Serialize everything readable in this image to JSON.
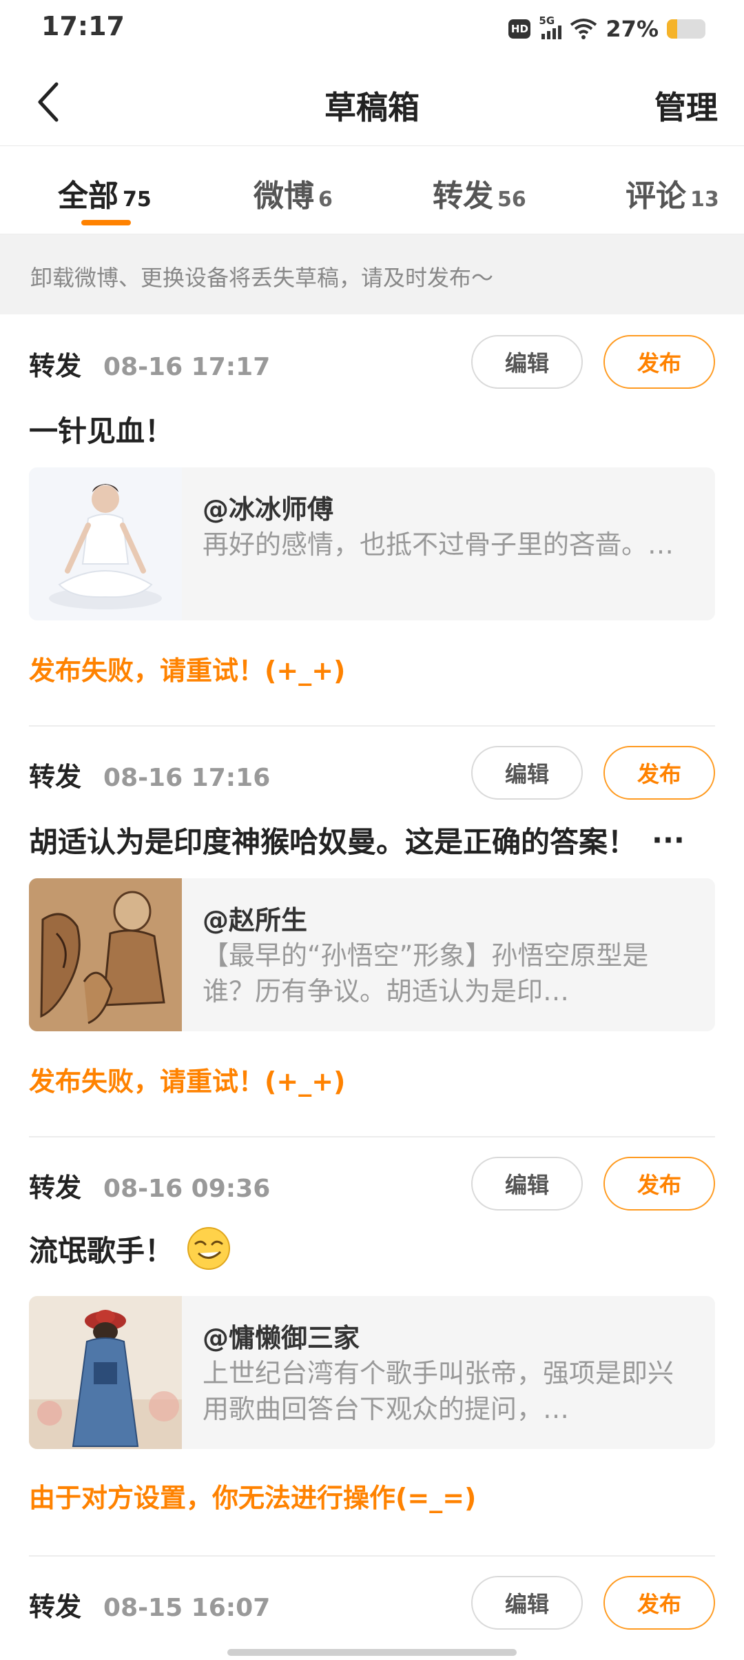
{
  "status_bar": {
    "time": "17:17",
    "hd": "HD",
    "network": "5G",
    "battery": "27%",
    "battery_level": 0.27
  },
  "header": {
    "title": "草稿箱",
    "manage_label": "管理"
  },
  "tabs": [
    {
      "label": "全部",
      "count": "75",
      "active": true
    },
    {
      "label": "微博",
      "count": "6",
      "active": false
    },
    {
      "label": "转发",
      "count": "56",
      "active": false
    },
    {
      "label": "评论",
      "count": "13",
      "active": false
    }
  ],
  "notice": "卸载微博、更换设备将丢失草稿，请及时发布～",
  "buttons": {
    "edit": "编辑",
    "publish": "发布"
  },
  "drafts": [
    {
      "type": "转发",
      "timestamp": "08-16 17:17",
      "text": "一针见血！",
      "more": "",
      "card": {
        "author": "@冰冰师傅",
        "excerpt": "再好的感情，也抵不过骨子里的吝啬。…"
      },
      "status": "发布失败，请重试！(+_+)"
    },
    {
      "type": "转发",
      "timestamp": "08-16 17:16",
      "text": "胡适认为是印度神猴哈奴曼。这是正确的答案！",
      "more": "···",
      "card": {
        "author": "@赵所生",
        "excerpt": "【最早的“孙悟空”形象】孙悟空原型是谁？历有争议。胡适认为是印…"
      },
      "status": "发布失败，请重试！(+_+)"
    },
    {
      "type": "转发",
      "timestamp": "08-16 09:36",
      "text": "流氓歌手！",
      "more": "",
      "card": {
        "author": "@慵懒御三家",
        "excerpt": "上世纪台湾有个歌手叫张帝，强项是即兴用歌曲回答台下观众的提问，…"
      },
      "status": "由于对方设置，你无法进行操作(=_=)"
    },
    {
      "type": "转发",
      "timestamp": "08-15 16:07",
      "text": "",
      "more": "",
      "card": null,
      "status": ""
    }
  ],
  "colors": {
    "accent": "#ff8200",
    "muted": "#999999",
    "card_bg": "#f5f5f5"
  }
}
